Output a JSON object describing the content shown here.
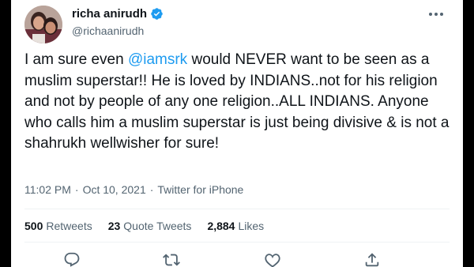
{
  "user": {
    "display_name": "richa anirudh",
    "handle": "@richaanirudh",
    "verified": true
  },
  "tweet": {
    "text_part1": "I am sure even ",
    "mention": "@iamsrk",
    "text_part2": " would NEVER want to be seen as a muslim superstar!! He is loved by INDIANS..not for his religion and not by people of any one religion..ALL INDIANS. Anyone who calls him a muslim superstar is just being divisive & is not a shahrukh wellwisher for sure!",
    "time": "11:02 PM",
    "date": "Oct 10, 2021",
    "separator": "·",
    "source": "Twitter for iPhone"
  },
  "stats": {
    "retweets_count": "500",
    "retweets_label": "Retweets",
    "quote_count": "23",
    "quote_label": "Quote Tweets",
    "likes_count": "2,884",
    "likes_label": "Likes"
  },
  "colors": {
    "accent": "#1d9bf0",
    "text": "#0f1419",
    "muted": "#536471"
  },
  "icons": {
    "reply": "reply-icon",
    "retweet": "retweet-icon",
    "like": "heart-icon",
    "share": "share-icon",
    "more": "more-dots-icon",
    "verified": "verified-badge-icon"
  }
}
